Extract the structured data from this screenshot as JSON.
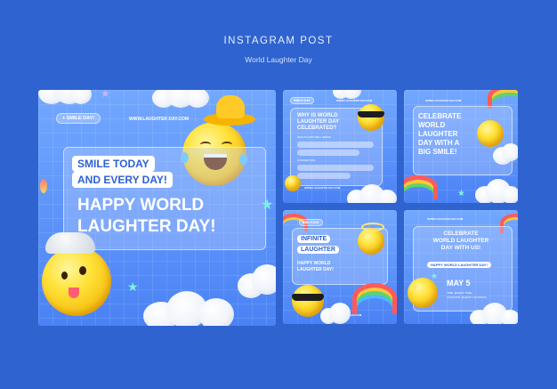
{
  "header": {
    "title": "INSTAGRAM POST",
    "subtitle": "World Laughter Day"
  },
  "main_card": {
    "pill": "+ SMILE DAY!",
    "url": "WWW.LAUGHTER DAY.COM",
    "line1": "SMILE TODAY",
    "line2": "AND EVERY DAY!",
    "headline1": "HAPPY WORLD",
    "headline2": "LAUGHTER DAY!"
  },
  "card_top_middle": {
    "pill": "SMILE DAY",
    "url": "WWW.LAUGHTER DAY.COM",
    "question1": "WHY IS WORLD",
    "question2": "LAUGHTER DAY",
    "question3": "CELEBRATED?",
    "label_a": "HEALTH AND WELL-BEING",
    "label_b": "CONNECTION",
    "footer_url": "WWW.LAUGHTER DAY.COM"
  },
  "card_top_right": {
    "url": "WWW.LAUGHTER DAY.COM",
    "line1": "CELEBRATE",
    "line2": "WORLD",
    "line3": "LAUGHTER",
    "line4": "DAY WITH A",
    "line5": "BIG SMILE!"
  },
  "card_bottom_middle": {
    "pill": "SMILE DAY",
    "line1": "INFINITE",
    "line2": "LAUGHTER",
    "line3": "HAPPY WORLD",
    "line4": "LAUGHTER DAY!",
    "url": "WWW.LAUGHTER DAY.COM"
  },
  "card_bottom_right": {
    "url": "WWW.LAUGHTER DAY.COM",
    "line1": "CELEBRATE",
    "line2": "WORLD LAUGHTER",
    "line3": "DAY WITH US!",
    "date": "MAY 5",
    "detail1": "TIME: [EVENT TIME]",
    "detail2": "LOCATION: [EVENT LOCATION]",
    "badge": "HAPPY WORLD LAUGHTER DAY!"
  },
  "colors": {
    "background": "#2f63cf",
    "card_blue": "#5a90fa",
    "accent_white": "#ffffff",
    "emoji_yellow": "#ffd91c"
  }
}
